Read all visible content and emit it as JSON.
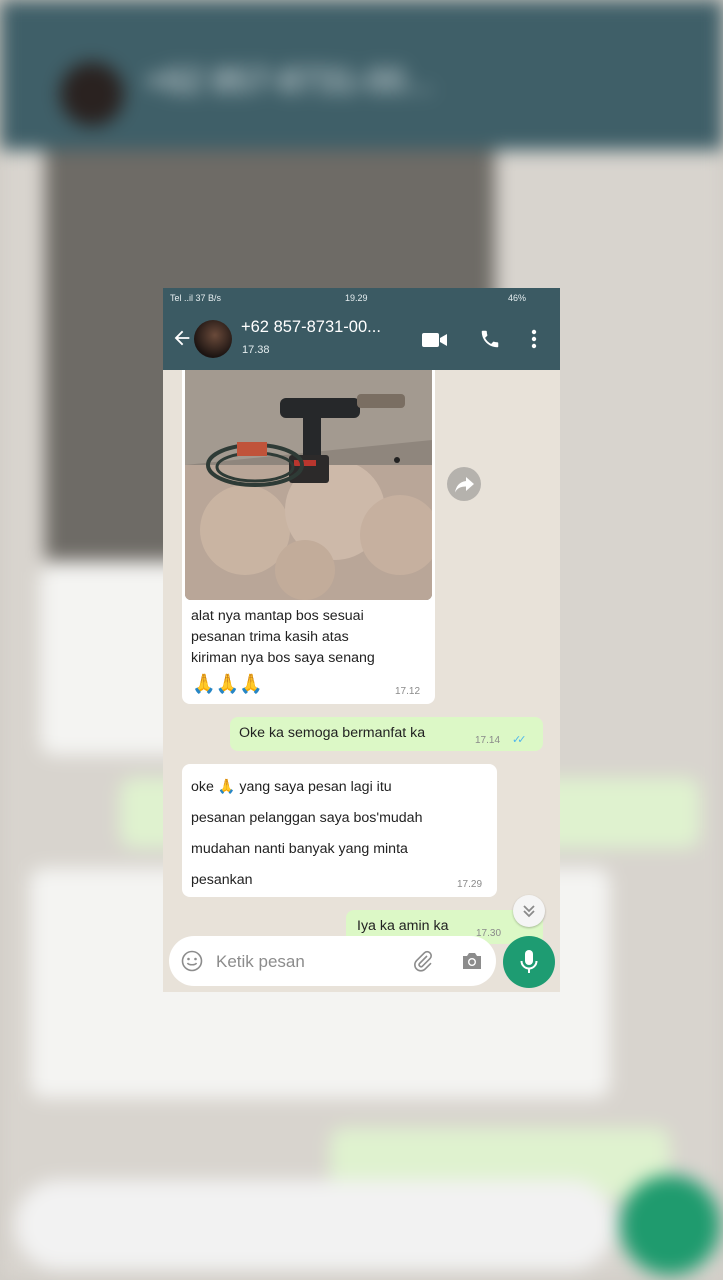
{
  "status_bar": {
    "left": "Tel ..il 37 B/s",
    "time": "19.29",
    "battery": "46%"
  },
  "header": {
    "contact_name": "+62 857-8731-00...",
    "last_seen": "17.38"
  },
  "messages": [
    {
      "direction": "incoming",
      "type": "image",
      "text": [
        "alat nya mantap bos sesuai",
        "pesanan trima kasih atas",
        "kiriman nya bos saya senang"
      ],
      "emoji": "🙏🙏🙏",
      "time": "17.12"
    },
    {
      "direction": "outgoing",
      "text": "Oke ka semoga bermanfat ka",
      "time": "17.14"
    },
    {
      "direction": "incoming",
      "text": [
        "oke 🙏 yang saya pesan lagi itu",
        "pesanan pelanggan saya bos'mudah",
        "mudahan nanti banyak yang minta",
        "pesankan"
      ],
      "time": "17.29"
    },
    {
      "direction": "outgoing",
      "text": "Iya ka amin ka",
      "time": "17.30"
    }
  ],
  "input": {
    "placeholder": "Ketik pesan"
  },
  "colors": {
    "header": "#3b5a63",
    "outgoing_bubble": "#dcf8c6",
    "incoming_bubble": "#ffffff",
    "chat_background": "#e8e2d9",
    "accent_green": "#1e9c72",
    "read_ticks": "#4fb6ec"
  },
  "icons": [
    "back-arrow-icon",
    "video-call-icon",
    "phone-icon",
    "more-vert-icon",
    "forward-icon",
    "scroll-down-icon",
    "emoji-icon",
    "attach-icon",
    "camera-icon",
    "mic-icon"
  ]
}
